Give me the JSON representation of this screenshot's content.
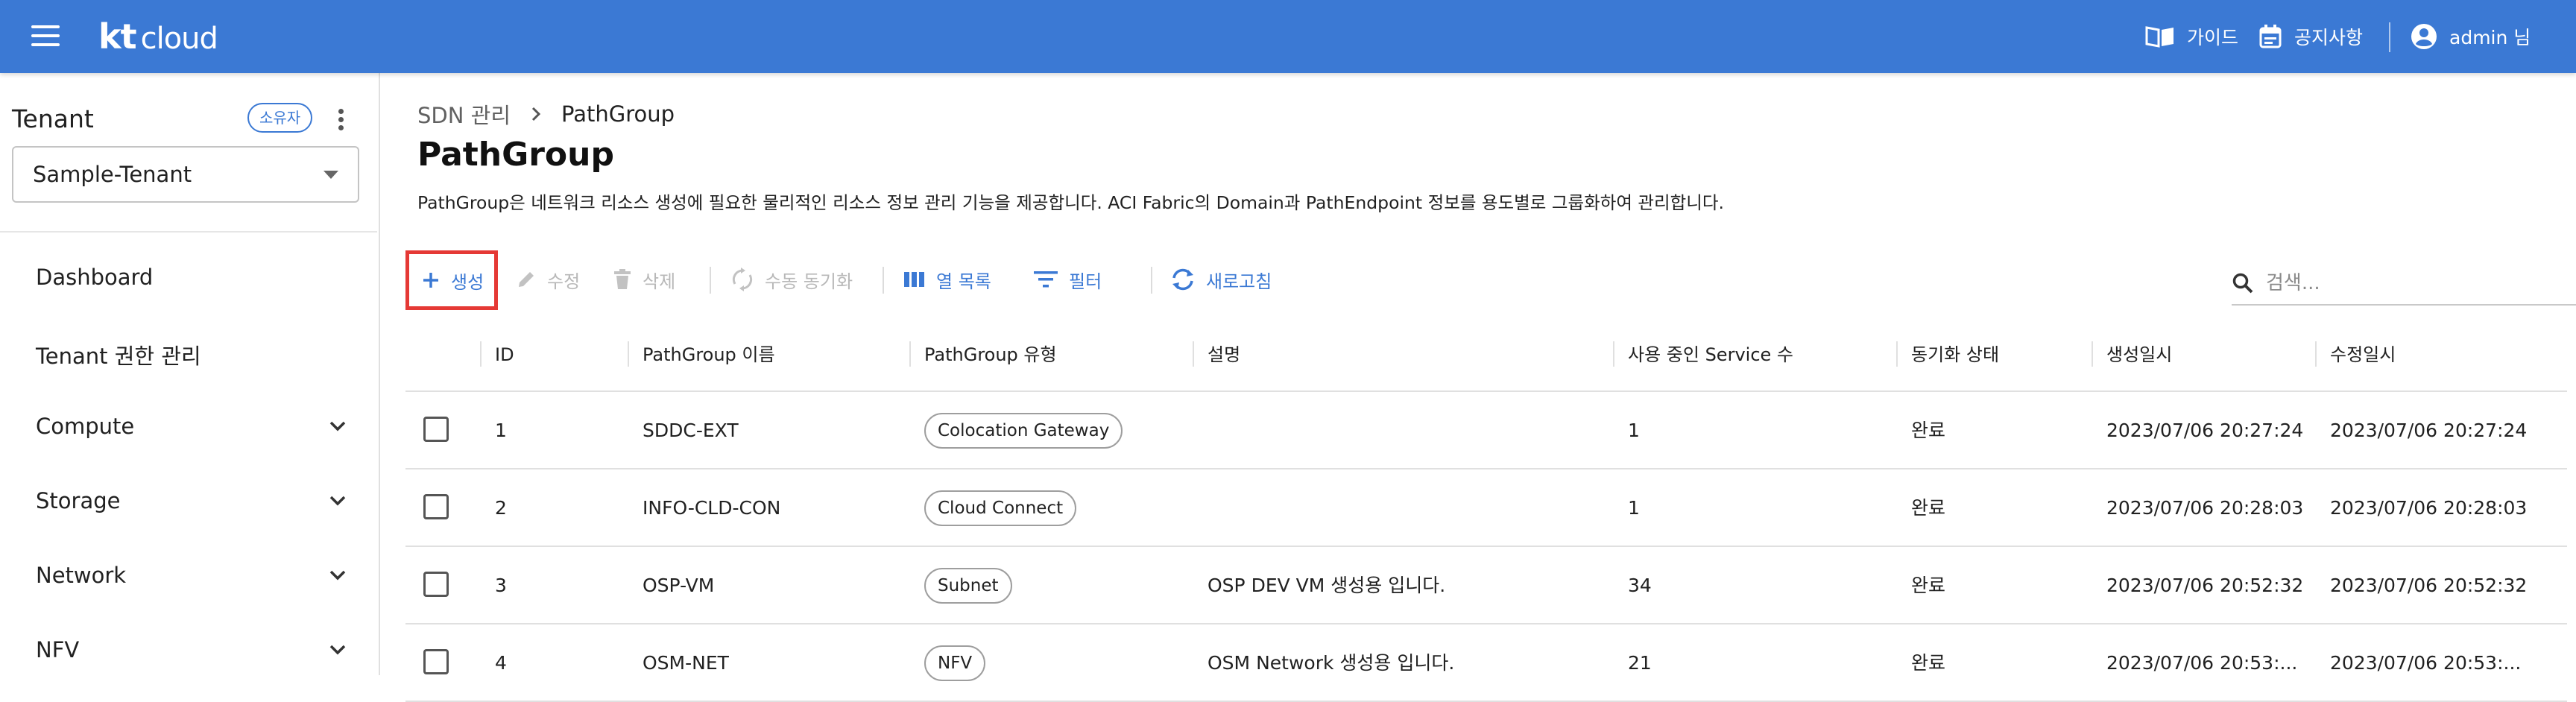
{
  "header": {
    "logo_kt": "kt",
    "logo_cloud": "cloud",
    "guide_label": "가이드",
    "notice_label": "공지사항",
    "user_label": "admin 님"
  },
  "sidebar": {
    "tenant_title": "Tenant",
    "owner_chip": "소유자",
    "tenant_selected": "Sample-Tenant",
    "items": [
      {
        "label": "Dashboard",
        "expandable": false
      },
      {
        "label": "Tenant 권한 관리",
        "expandable": false
      },
      {
        "label": "Compute",
        "expandable": true
      },
      {
        "label": "Storage",
        "expandable": true
      },
      {
        "label": "Network",
        "expandable": true
      },
      {
        "label": "NFV",
        "expandable": true
      }
    ]
  },
  "breadcrumb": {
    "root": "SDN 관리",
    "current": "PathGroup"
  },
  "page": {
    "title": "PathGroup",
    "description": "PathGroup은 네트워크 리소스 생성에 필요한 물리적인 리소스 정보 관리 기능을 제공합니다. ACI Fabric의 Domain과 PathEndpoint 정보를 용도별로 그룹화하여 관리합니다."
  },
  "toolbar": {
    "create": "생성",
    "edit": "수정",
    "delete": "삭제",
    "manual_sync": "수동 동기화",
    "columns": "열 목록",
    "filter": "필터",
    "refresh": "새로고침",
    "search_placeholder": "검색..."
  },
  "colors": {
    "appbar": "#3b79d4",
    "accent": "#3b79d4",
    "highlight": "#e53935"
  },
  "table": {
    "columns": [
      "ID",
      "PathGroup 이름",
      "PathGroup 유형",
      "설명",
      "사용 중인 Service 수",
      "동기화 상태",
      "생성일시",
      "수정일시"
    ],
    "rows": [
      {
        "id": "1",
        "name": "SDDC-EXT",
        "type": "Colocation Gateway",
        "desc": "",
        "services": "1",
        "sync": "완료",
        "created": "2023/07/06 20:27:24",
        "updated": "2023/07/06 20:27:24"
      },
      {
        "id": "2",
        "name": "INFO-CLD-CON",
        "type": "Cloud Connect",
        "desc": "",
        "services": "1",
        "sync": "완료",
        "created": "2023/07/06 20:28:03",
        "updated": "2023/07/06 20:28:03"
      },
      {
        "id": "3",
        "name": "OSP-VM",
        "type": "Subnet",
        "desc": "OSP DEV VM 생성용 입니다.",
        "services": "34",
        "sync": "완료",
        "created": "2023/07/06 20:52:32",
        "updated": "2023/07/06 20:52:32"
      },
      {
        "id": "4",
        "name": "OSM-NET",
        "type": "NFV",
        "desc": "OSM Network 생성용 입니다.",
        "services": "21",
        "sync": "완료",
        "created": "2023/07/06 20:53:...",
        "updated": "2023/07/06 20:53:..."
      }
    ]
  }
}
